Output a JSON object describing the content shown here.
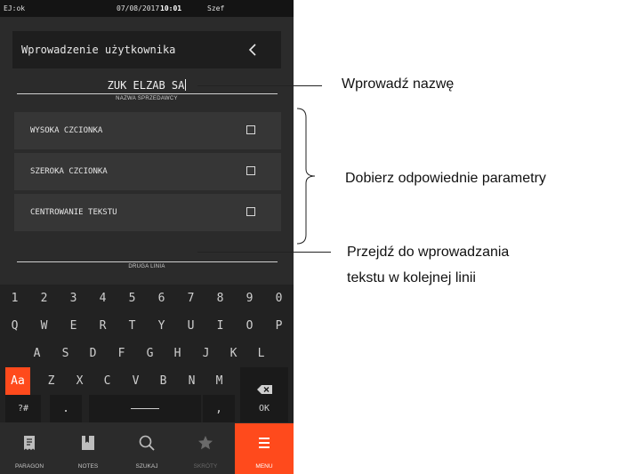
{
  "status": {
    "left": "EJ:ok",
    "date": "07/08/2017",
    "time": "10:01",
    "user": "Szef"
  },
  "header": {
    "title": "Wprowadzenie użytkownika",
    "back_icon": "chevron-left-icon"
  },
  "name_field": {
    "value": "ZUK ELZAB SA",
    "label": "NAZWA SPRZEDAWCY"
  },
  "options": [
    {
      "label": "WYSOKA CZCIONKA",
      "checked": false
    },
    {
      "label": "SZEROKA CZCIONKA",
      "checked": false
    },
    {
      "label": "CENTROWANIE TEKSTU",
      "checked": false
    }
  ],
  "second_line_field": {
    "value": "",
    "label": "DRUGA LINIA"
  },
  "keyboard": {
    "row1": [
      "1",
      "2",
      "3",
      "4",
      "5",
      "6",
      "7",
      "8",
      "9",
      "0"
    ],
    "row2": [
      "Q",
      "W",
      "E",
      "R",
      "T",
      "Y",
      "U",
      "I",
      "O",
      "P"
    ],
    "row3": [
      "A",
      "S",
      "D",
      "F",
      "G",
      "H",
      "J",
      "K",
      "L"
    ],
    "row4": {
      "shift": "Aa",
      "keys": [
        "Z",
        "X",
        "C",
        "V",
        "B",
        "N",
        "M"
      ],
      "backspace": "backspace-icon"
    },
    "row5": {
      "symbols": "?#",
      "dot": ".",
      "comma": ",",
      "ok": "OK"
    }
  },
  "nav": [
    {
      "label": "PARAGON",
      "icon": "receipt-icon",
      "active": false,
      "dim": false
    },
    {
      "label": "NOTES",
      "icon": "bookmark-icon",
      "active": false,
      "dim": false
    },
    {
      "label": "SZUKAJ",
      "icon": "search-icon",
      "active": false,
      "dim": false
    },
    {
      "label": "SKRÓTY",
      "icon": "star-icon",
      "active": false,
      "dim": true
    },
    {
      "label": "MENU",
      "icon": "menu-icon",
      "active": true,
      "dim": false
    }
  ],
  "annotations": {
    "enter_name": "Wprowadź nazwę",
    "choose_params": "Dobierz odpowiednie parametry",
    "next_line_1": "Przejdź do wprowadzania",
    "next_line_2": "tekstu w kolejnej linii"
  },
  "colors": {
    "accent": "#ff4a1c",
    "background": "#2b2b2b",
    "panel": "#363636",
    "statusbar": "#141414"
  }
}
